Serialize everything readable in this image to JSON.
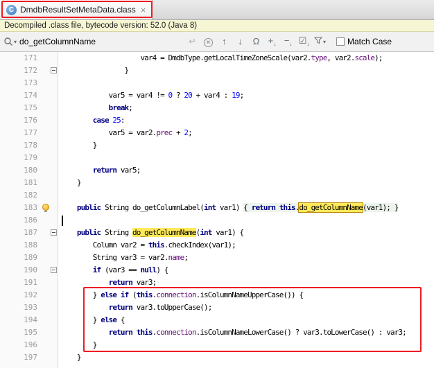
{
  "colors": {
    "annotation": "#ED1C24",
    "keyword": "#000080",
    "number": "#0000FF",
    "field": "#660E7A",
    "search_highlight": "#FFE959"
  },
  "tab_bar": {
    "tab": {
      "title": "DmdbResultSetMetaData.class",
      "icon": "C",
      "close_glyph": "×"
    }
  },
  "banner": {
    "text": "Decompiled .class file, bytecode version: 52.0 (Java 8)"
  },
  "find_bar": {
    "query": "do_getColumnName",
    "match_case_label": "Match Case",
    "icons": {
      "search_chevron": "▾",
      "newline": "↵",
      "clear": "×",
      "prev": "↑",
      "next": "↓",
      "word": "Ω",
      "add_selection": "+",
      "unselect": "−",
      "select_all": "☑",
      "sub_arrow": "↓",
      "filter_chevron": "▾"
    }
  },
  "editor": {
    "lines": [
      {
        "num": "171",
        "segs": [
          {
            "t": "                    var4 = DmdbType.getLocalTimeZoneScale(var2.",
            "c": "p"
          },
          {
            "t": "type",
            "c": "f"
          },
          {
            "t": ", var2.",
            "c": "p"
          },
          {
            "t": "scale",
            "c": "f"
          },
          {
            "t": ");",
            "c": "p"
          }
        ]
      },
      {
        "num": "172",
        "fold": true,
        "segs": [
          {
            "t": "                }",
            "c": "p"
          }
        ]
      },
      {
        "num": "173",
        "segs": []
      },
      {
        "num": "174",
        "segs": [
          {
            "t": "            var5 = var4 != ",
            "c": "p"
          },
          {
            "t": "0",
            "c": "n"
          },
          {
            "t": " ? ",
            "c": "p"
          },
          {
            "t": "20",
            "c": "n"
          },
          {
            "t": " + var4 : ",
            "c": "p"
          },
          {
            "t": "19",
            "c": "n"
          },
          {
            "t": ";",
            "c": "p"
          }
        ]
      },
      {
        "num": "175",
        "segs": [
          {
            "t": "            ",
            "c": "p"
          },
          {
            "t": "break",
            "c": "k"
          },
          {
            "t": ";",
            "c": "p"
          }
        ]
      },
      {
        "num": "176",
        "segs": [
          {
            "t": "        ",
            "c": "p"
          },
          {
            "t": "case ",
            "c": "k"
          },
          {
            "t": "25",
            "c": "n"
          },
          {
            "t": ":",
            "c": "p"
          }
        ]
      },
      {
        "num": "177",
        "segs": [
          {
            "t": "            var5 = var2.",
            "c": "p"
          },
          {
            "t": "prec",
            "c": "f"
          },
          {
            "t": " + ",
            "c": "p"
          },
          {
            "t": "2",
            "c": "n"
          },
          {
            "t": ";",
            "c": "p"
          }
        ]
      },
      {
        "num": "178",
        "segs": [
          {
            "t": "        }",
            "c": "p"
          }
        ]
      },
      {
        "num": "179",
        "segs": []
      },
      {
        "num": "180",
        "segs": [
          {
            "t": "        ",
            "c": "p"
          },
          {
            "t": "return",
            "c": "k"
          },
          {
            "t": " var5;",
            "c": "p"
          }
        ]
      },
      {
        "num": "181",
        "segs": [
          {
            "t": "    }",
            "c": "p"
          }
        ]
      },
      {
        "num": "182",
        "segs": []
      },
      {
        "num": "183",
        "bulb": true,
        "segs": [
          {
            "t": "    ",
            "c": "p"
          },
          {
            "t": "public ",
            "c": "k"
          },
          {
            "t": "String do_getColumnLabel(",
            "c": "p"
          },
          {
            "t": "int",
            "c": "k"
          },
          {
            "t": " var1) ",
            "c": "p"
          },
          {
            "t": "{ ",
            "c": "p",
            "bg": "fold"
          },
          {
            "t": "return ",
            "c": "k",
            "bg": "fold"
          },
          {
            "t": "this",
            "c": "k",
            "bg": "fold"
          },
          {
            "t": ".",
            "c": "p",
            "bg": "fold"
          },
          {
            "t": "do_getColumnName",
            "c": "hlc",
            "bg": "fold"
          },
          {
            "t": "(var1); }",
            "c": "p",
            "bg": "fold"
          }
        ]
      },
      {
        "num": "186",
        "cursor": true,
        "segs": []
      },
      {
        "num": "187",
        "fold": true,
        "segs": [
          {
            "t": "    ",
            "c": "p"
          },
          {
            "t": "public ",
            "c": "k"
          },
          {
            "t": "String ",
            "c": "p"
          },
          {
            "t": "do_getColumnName",
            "c": "hl"
          },
          {
            "t": "(",
            "c": "p"
          },
          {
            "t": "int",
            "c": "k"
          },
          {
            "t": " var1) {",
            "c": "p"
          }
        ]
      },
      {
        "num": "188",
        "segs": [
          {
            "t": "        Column var2 = ",
            "c": "p"
          },
          {
            "t": "this",
            "c": "k"
          },
          {
            "t": ".checkIndex(var1);",
            "c": "p"
          }
        ]
      },
      {
        "num": "189",
        "segs": [
          {
            "t": "        String var3 = var2.",
            "c": "p"
          },
          {
            "t": "name",
            "c": "f"
          },
          {
            "t": ";",
            "c": "p"
          }
        ]
      },
      {
        "num": "190",
        "fold": true,
        "segs": [
          {
            "t": "        ",
            "c": "p"
          },
          {
            "t": "if ",
            "c": "k"
          },
          {
            "t": "(var3 == ",
            "c": "p"
          },
          {
            "t": "null",
            "c": "k"
          },
          {
            "t": ") {",
            "c": "p"
          }
        ]
      },
      {
        "num": "191",
        "segs": [
          {
            "t": "            ",
            "c": "p"
          },
          {
            "t": "return",
            "c": "k"
          },
          {
            "t": " var3;",
            "c": "p"
          }
        ]
      },
      {
        "num": "192",
        "segs": [
          {
            "t": "        } ",
            "c": "p"
          },
          {
            "t": "else if ",
            "c": "k"
          },
          {
            "t": "(",
            "c": "p"
          },
          {
            "t": "this",
            "c": "k"
          },
          {
            "t": ".",
            "c": "p"
          },
          {
            "t": "connection",
            "c": "f"
          },
          {
            "t": ".isColumnNameUpperCase()) {",
            "c": "p"
          }
        ]
      },
      {
        "num": "193",
        "segs": [
          {
            "t": "            ",
            "c": "p"
          },
          {
            "t": "return",
            "c": "k"
          },
          {
            "t": " var3.toUpperCase();",
            "c": "p"
          }
        ]
      },
      {
        "num": "194",
        "segs": [
          {
            "t": "        } ",
            "c": "p"
          },
          {
            "t": "else",
            "c": "k"
          },
          {
            "t": " {",
            "c": "p"
          }
        ]
      },
      {
        "num": "195",
        "segs": [
          {
            "t": "            ",
            "c": "p"
          },
          {
            "t": "return ",
            "c": "k"
          },
          {
            "t": "this",
            "c": "k"
          },
          {
            "t": ".",
            "c": "p"
          },
          {
            "t": "connection",
            "c": "f"
          },
          {
            "t": ".isColumnNameLowerCase() ? var3.toLowerCase() : var3;",
            "c": "p"
          }
        ]
      },
      {
        "num": "196",
        "segs": [
          {
            "t": "        }",
            "c": "p"
          }
        ]
      },
      {
        "num": "197",
        "segs": [
          {
            "t": "    }",
            "c": "p"
          }
        ]
      }
    ]
  }
}
